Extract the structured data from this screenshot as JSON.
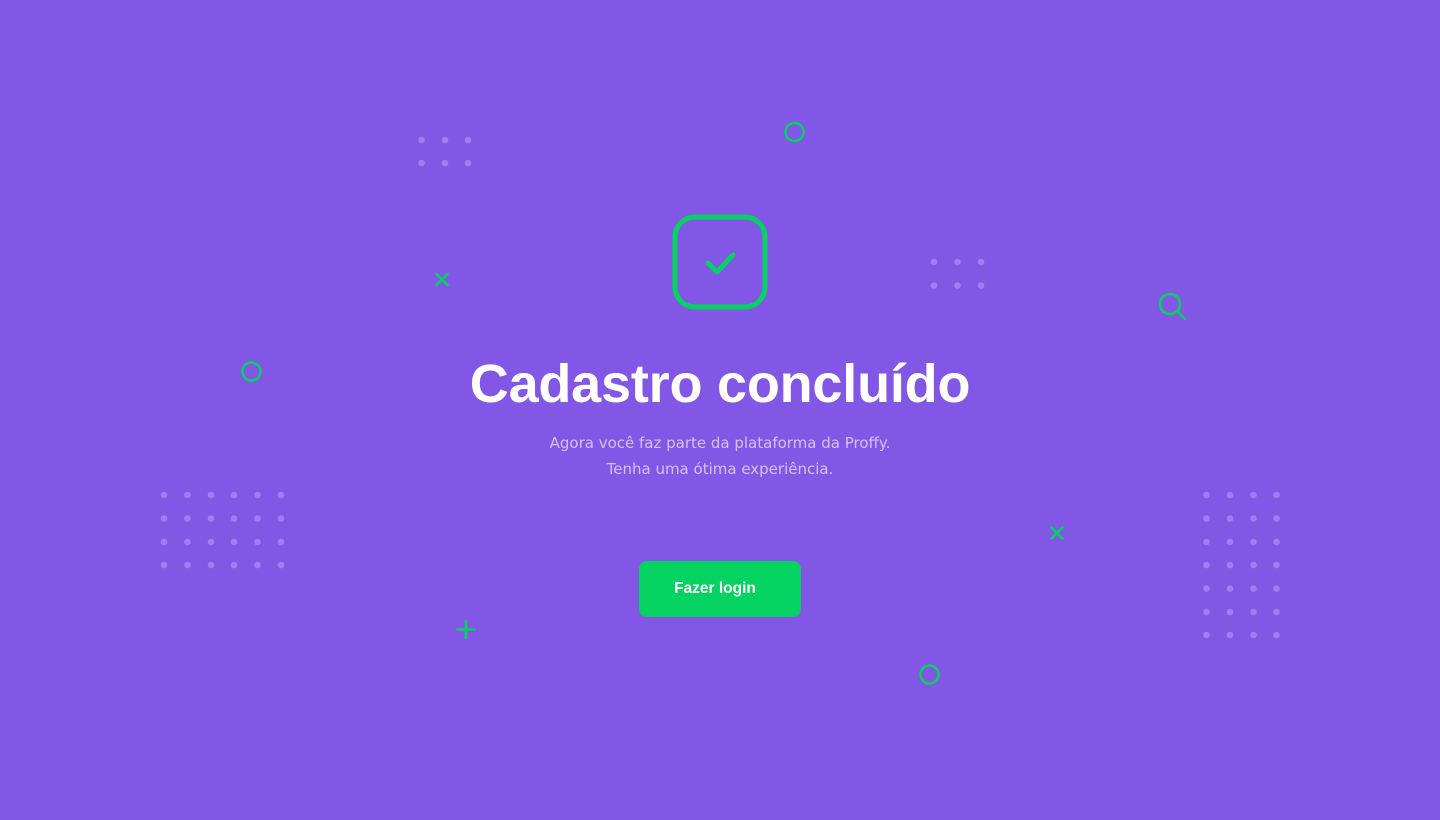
{
  "success": {
    "title": "Cadastro concluído",
    "description_line_1": "Agora você faz parte da plataforma da Proffy.",
    "description_line_2": "Tenha uma ótima experiência.",
    "button_label": "Fazer login",
    "icon": "check-icon"
  },
  "background": {
    "decorations": [
      "circle-icon",
      "x-icon",
      "plus-icon",
      "search-icon",
      "dot-grid"
    ]
  },
  "colors": {
    "background": "#8257E5",
    "accent_green": "#04D361",
    "title": "#FFFFFF",
    "subtitle": "#D4C2FF",
    "dots": "#A07EF0"
  }
}
